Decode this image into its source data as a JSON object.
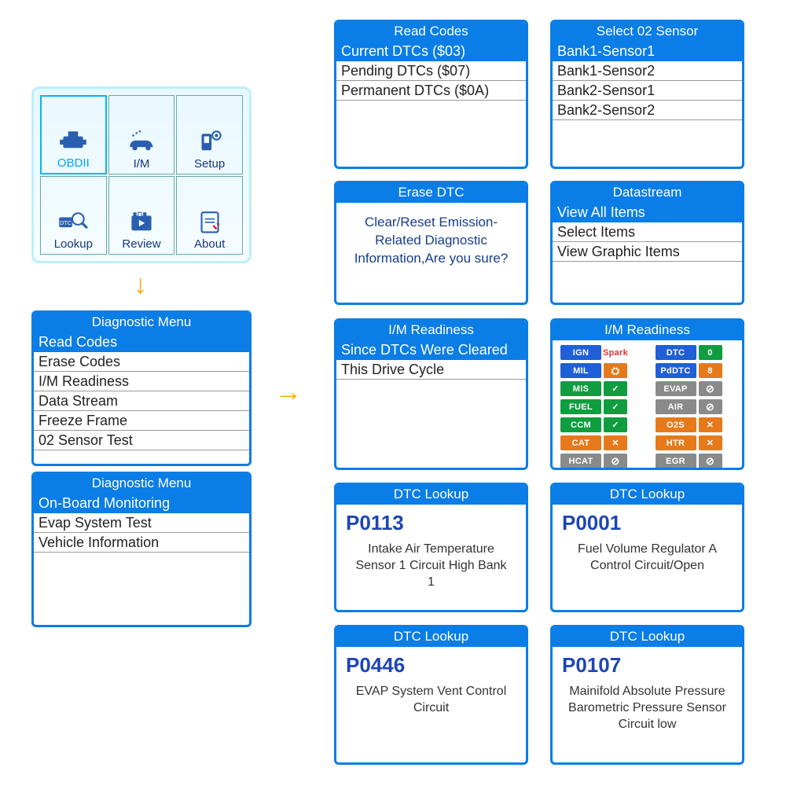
{
  "home": {
    "items": [
      "OBDII",
      "I/M",
      "Setup",
      "Lookup",
      "Review",
      "About"
    ],
    "selected": 0
  },
  "diagnostic1": {
    "title": "Diagnostic Menu",
    "items": [
      "Read Codes",
      "Erase Codes",
      "I/M Readiness",
      "Data Stream",
      "Freeze Frame",
      "02 Sensor Test"
    ],
    "selected": 0
  },
  "diagnostic2": {
    "title": "Diagnostic Menu",
    "items": [
      "On-Board Monitoring",
      "Evap System Test",
      "Vehicle Information"
    ],
    "selected": 0
  },
  "readCodes": {
    "title": "Read Codes",
    "items": [
      "Current DTCs ($03)",
      "Pending DTCs ($07)",
      "Permanent DTCs ($0A)"
    ],
    "selected": 0
  },
  "selectO2": {
    "title": "Select 02 Sensor",
    "items": [
      "Bank1-Sensor1",
      "Bank1-Sensor2",
      "Bank2-Sensor1",
      "Bank2-Sensor2"
    ],
    "selected": 0
  },
  "eraseDTC": {
    "title": "Erase DTC",
    "body": "Clear/Reset Emission-Related Diagnostic Information,Are you sure?"
  },
  "datastream": {
    "title": "Datastream",
    "items": [
      "View All Items",
      "Select Items",
      "View Graphic Items"
    ],
    "selected": 0
  },
  "imReadiness1": {
    "title": "I/M Readiness",
    "items": [
      "Since DTCs Were Cleared",
      "This Drive Cycle"
    ],
    "selected": 0
  },
  "imReadiness2": {
    "title": "I/M Readiness",
    "left": [
      {
        "label": "IGN",
        "class": "blue",
        "val": "Spark",
        "valClass": "red"
      },
      {
        "label": "MIL",
        "class": "blue",
        "val": "engine-icon",
        "valClass": "orange"
      },
      {
        "label": "MIS",
        "class": "green",
        "val": "tick",
        "valClass": "green"
      },
      {
        "label": "FUEL",
        "class": "green",
        "val": "tick",
        "valClass": "green"
      },
      {
        "label": "CCM",
        "class": "green",
        "val": "tick",
        "valClass": "green"
      },
      {
        "label": "CAT",
        "class": "orange",
        "val": "x",
        "valClass": "orange"
      },
      {
        "label": "HCAT",
        "class": "grey",
        "val": "na",
        "valClass": "grey"
      }
    ],
    "right": [
      {
        "label": "DTC",
        "class": "blue",
        "val": "0",
        "valClass": "green"
      },
      {
        "label": "PdDTC",
        "class": "blue",
        "val": "8",
        "valClass": "orange"
      },
      {
        "label": "EVAP",
        "class": "grey",
        "val": "na",
        "valClass": "grey"
      },
      {
        "label": "AIR",
        "class": "grey",
        "val": "na",
        "valClass": "grey"
      },
      {
        "label": "O2S",
        "class": "orange",
        "val": "x",
        "valClass": "orange"
      },
      {
        "label": "HTR",
        "class": "orange",
        "val": "x",
        "valClass": "orange"
      },
      {
        "label": "EGR",
        "class": "grey",
        "val": "na",
        "valClass": "grey"
      }
    ]
  },
  "dtc": [
    {
      "title": "DTC Lookup",
      "code": "P0113",
      "desc": "Intake Air Temperature Sensor 1 Circuit High Bank 1"
    },
    {
      "title": "DTC Lookup",
      "code": "P0001",
      "desc": "Fuel Volume Regulator A Control Circuit/Open"
    },
    {
      "title": "DTC Lookup",
      "code": "P0446",
      "desc": "EVAP System Vent Control Circuit"
    },
    {
      "title": "DTC Lookup",
      "code": "P0107",
      "desc": "Mainifold Absolute Pressure Barometric Pressure Sensor Circuit low"
    }
  ]
}
